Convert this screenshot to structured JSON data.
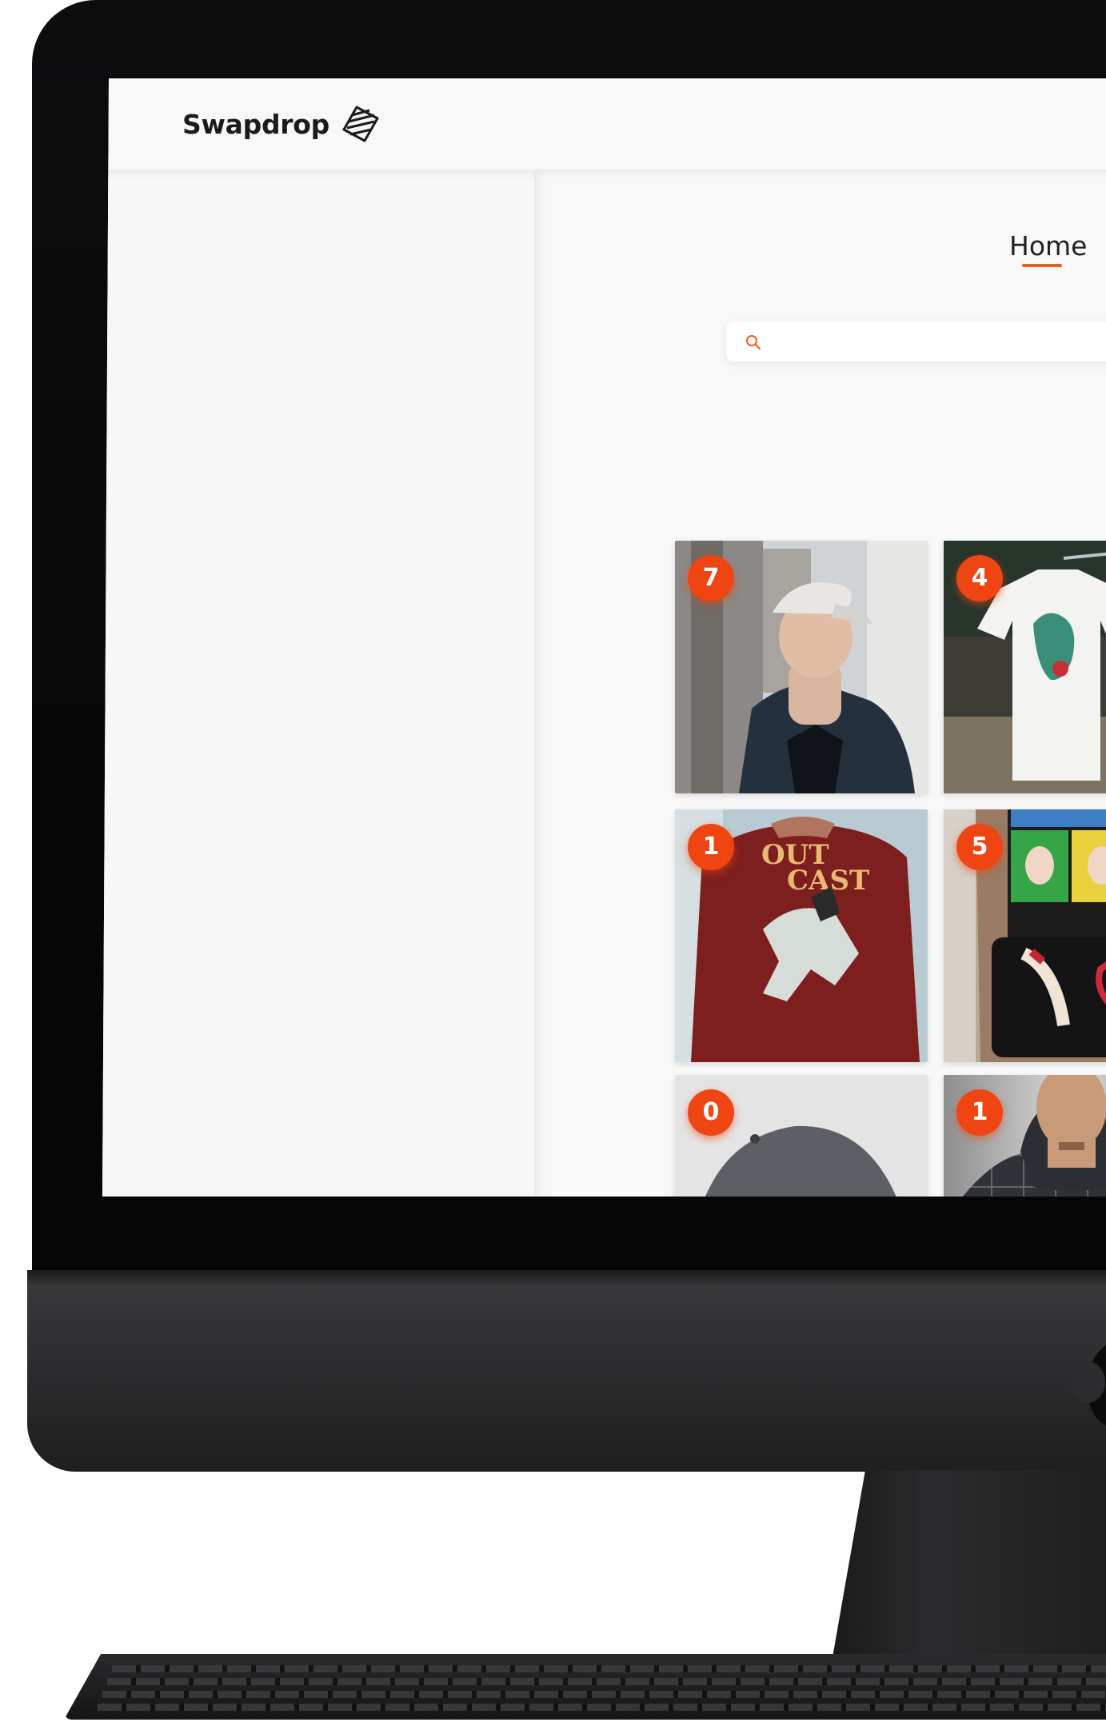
{
  "app": {
    "brand_name": "Swapdrop",
    "logo_icon": "striped-diamond-logo-icon"
  },
  "nav": {
    "home_label": "Home"
  },
  "search": {
    "placeholder": "",
    "value": ""
  },
  "products": [
    {
      "badge": "7",
      "subject": "man-in-cap-and-puffer-jacket"
    },
    {
      "badge": "4",
      "subject": "white-graphic-tshirt-on-hanger"
    },
    {
      "badge": "1",
      "subject": "red-outcast-tshirt"
    },
    {
      "badge": "5",
      "subject": "painted-graphic-tshirt-and-bag"
    },
    {
      "badge": "0",
      "subject": "grey-baseball-cap"
    },
    {
      "badge": "1",
      "subject": "man-in-patterned-windbreaker"
    }
  ],
  "colors": {
    "accent": "#ee4512",
    "nav_underline": "#ef5a1e",
    "screen_bg": "#f7f7f7",
    "bezel": "#0a0a0a"
  }
}
